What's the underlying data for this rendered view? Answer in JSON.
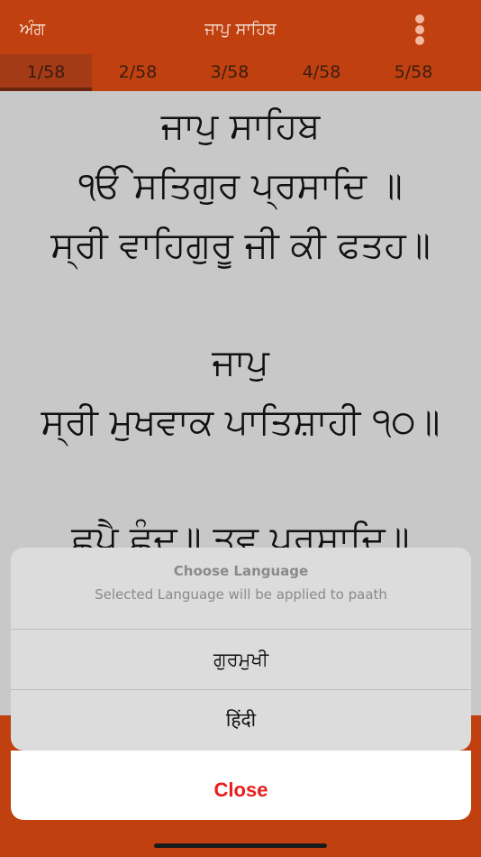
{
  "header": {
    "left_label": "ਅੰਗ",
    "title": "ਜਾਪੁ ਸਾਹਿਬ",
    "menu_icon": "more-vertical-icon"
  },
  "tabs": [
    {
      "label": "1/58",
      "active": true
    },
    {
      "label": "2/58",
      "active": false
    },
    {
      "label": "3/58",
      "active": false
    },
    {
      "label": "4/58",
      "active": false
    },
    {
      "label": "5/58",
      "active": false
    }
  ],
  "paath": {
    "lines": [
      "ਜਾਪੁ ਸਾਹਿਬ",
      "ੴ ਸਤਿਗੁਰ ਪ੍ਰਸਾਦਿ ॥",
      "ਸ੍ਰੀ ਵਾਹਿਗੁਰੂ ਜੀ ਕੀ ਫਤਹ॥",
      "ਜਾਪੁ",
      "ਸ੍ਰੀ ਮੁਖਵਾਕ ਪਾਤਿਸ਼ਾਹੀ ੧੦॥",
      "ਛਪੈ ਛੰਦ॥ ਤ੍ਵ ਪ੍ਰਸਾਦਿ॥"
    ]
  },
  "sheet": {
    "title": "Choose Language",
    "message": "Selected Language will be applied to paath",
    "options": [
      "ਗੁਰਮੁਖੀ",
      "हिंदी"
    ],
    "close_label": "Close"
  },
  "colors": {
    "brand": "#c0400f",
    "close": "#ea1c1c"
  }
}
